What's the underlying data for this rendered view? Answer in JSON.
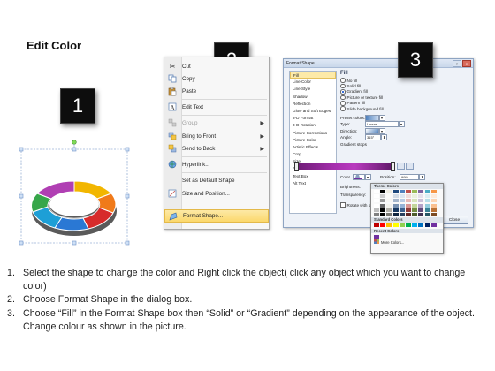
{
  "title": "Edit Color",
  "badges": [
    "1",
    "2",
    "3"
  ],
  "context_menu": {
    "items": [
      {
        "label": "Cut",
        "icon": "scissors-icon",
        "enabled": true
      },
      {
        "label": "Copy",
        "icon": "copy-icon",
        "enabled": true
      },
      {
        "label": "Paste",
        "icon": "paste-icon",
        "enabled": true
      },
      {
        "label": "Edit Text",
        "icon": "edit-text-icon",
        "enabled": true
      },
      {
        "label": "Group",
        "icon": "group-icon",
        "enabled": false,
        "submenu": true
      },
      {
        "label": "Bring to Front",
        "icon": "bring-to-front-icon",
        "enabled": true,
        "submenu": true
      },
      {
        "label": "Send to Back",
        "icon": "send-to-back-icon",
        "enabled": true,
        "submenu": true
      },
      {
        "label": "Hyperlink...",
        "icon": "hyperlink-icon",
        "enabled": true
      },
      {
        "label": "Set as Default Shape",
        "icon": "",
        "enabled": true
      },
      {
        "label": "Size and Position...",
        "icon": "size-position-icon",
        "enabled": true
      },
      {
        "label": "Format Shape...",
        "icon": "format-shape-icon",
        "enabled": true,
        "highlighted": true
      }
    ]
  },
  "dialog": {
    "title": "Format Shape",
    "categories": [
      "Fill",
      "Line Color",
      "Line Style",
      "Shadow",
      "Reflection",
      "Glow and Soft Edges",
      "3-D Format",
      "3-D Rotation",
      "Picture Corrections",
      "Picture Color",
      "Artistic Effects",
      "Crop",
      "Size",
      "Position",
      "Text Box",
      "Alt Text"
    ],
    "selected_category": "Fill",
    "fill_heading": "Fill",
    "fill_options": [
      "No fill",
      "Solid fill",
      "Gradient fill",
      "Picture or texture fill",
      "Pattern fill",
      "Slide background fill"
    ],
    "fill_selected": "Gradient fill",
    "preset_label": "Preset colors:",
    "type_label": "Type:",
    "type_value": "Linear",
    "direction_label": "Direction:",
    "angle_label": "Angle:",
    "angle_value": "315°",
    "gradient_stops_label": "Gradient stops",
    "color_label": "Color",
    "position_label": "Position:",
    "position_value": "99%",
    "brightness_label": "Brightness:",
    "transparency_label": "Transparency:",
    "rotate_label": "Rotate with shape",
    "close_label": "Close"
  },
  "palette": {
    "theme_heading": "Theme Colors",
    "standard_heading": "Standard Colors",
    "recent_heading": "Recent Colors",
    "more_label": "More Colors...",
    "theme_top": [
      "#ffffff",
      "#000000",
      "#eeece1",
      "#1f497d",
      "#4f81bd",
      "#c0504d",
      "#9bbb59",
      "#8064a2",
      "#4bacc6",
      "#f79646"
    ],
    "standard": [
      "#c00000",
      "#ff0000",
      "#ffc000",
      "#ffff00",
      "#92d050",
      "#00b050",
      "#00b0f0",
      "#0070c0",
      "#002060",
      "#7030a0"
    ],
    "recent": [
      "#7030a0"
    ]
  },
  "steps": [
    {
      "num": "1.",
      "text": "Select the shape to change the color and Right click the object( click any object which you want to change color)"
    },
    {
      "num": "2.",
      "text": "Choose Format Shape in the dialog box."
    },
    {
      "num": "3.",
      "text": "Choose “Fill” in the Format Shape box then “Solid” or “Gradient” depending on the appearance of the object. Change colour as shown in the picture."
    }
  ]
}
